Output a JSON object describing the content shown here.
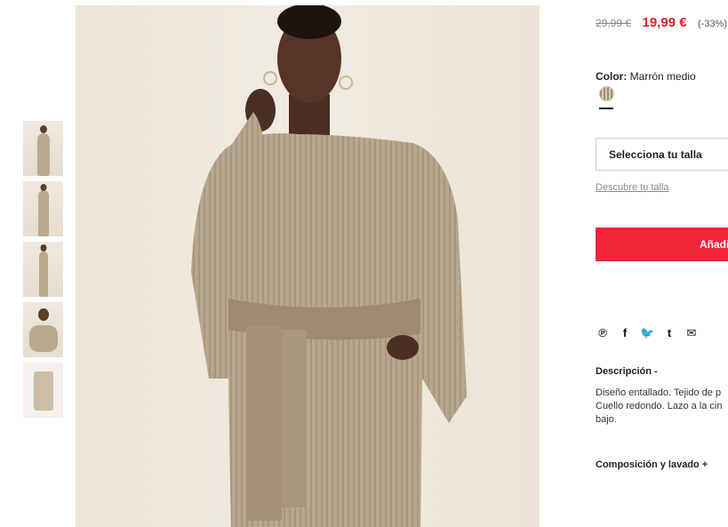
{
  "product": {
    "price_old": "29,99 €",
    "price_new": "19,99 €",
    "discount": "(-33%)",
    "color_label": "Color:",
    "color_value": "Marrón medio",
    "size_select": "Selecciona tu talla",
    "size_guide": "Descubre tu talla",
    "add_button": "Añadi"
  },
  "share": {
    "icons": [
      "pinterest-icon",
      "facebook-icon",
      "twitter-icon",
      "tumblr-icon",
      "email-icon"
    ],
    "glyphs": [
      "℗",
      "f",
      "🐦",
      "t",
      "✉"
    ]
  },
  "description": {
    "title": "Descripción -",
    "lines": [
      "Diseño entallado. Tejido de p",
      "Cuello redondo. Lazo a la cin",
      "bajo."
    ]
  },
  "composition": {
    "title": "Composición y lavado +"
  },
  "colors": {
    "accent": "#e3212e",
    "button": "#f2243a"
  }
}
